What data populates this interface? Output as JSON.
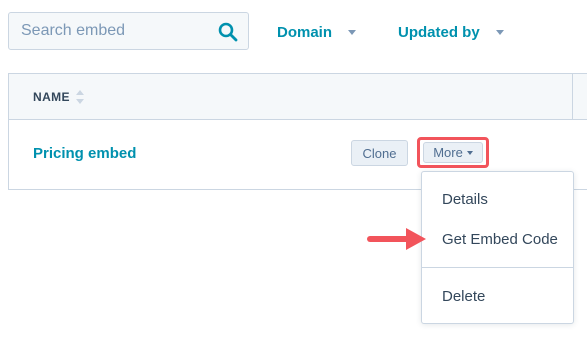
{
  "search": {
    "placeholder": "Search embed",
    "value": ""
  },
  "filters": {
    "domain_label": "Domain",
    "updated_by_label": "Updated by"
  },
  "table": {
    "columns": [
      {
        "label": "NAME"
      }
    ],
    "rows": [
      {
        "name": "Pricing embed",
        "clone_label": "Clone",
        "more_label": "More"
      }
    ]
  },
  "dropdown": {
    "items": [
      {
        "label": "Details"
      },
      {
        "label": "Get Embed Code"
      },
      {
        "label": "Delete"
      }
    ]
  },
  "colors": {
    "link": "#0091ae",
    "text": "#33475b",
    "border": "#cbd6e2",
    "annotation": "#f2545b"
  },
  "icons": {
    "search": "search-icon",
    "sort": "sort-icon",
    "caret": "caret-down-icon",
    "arrow": "annotation-arrow-icon"
  }
}
